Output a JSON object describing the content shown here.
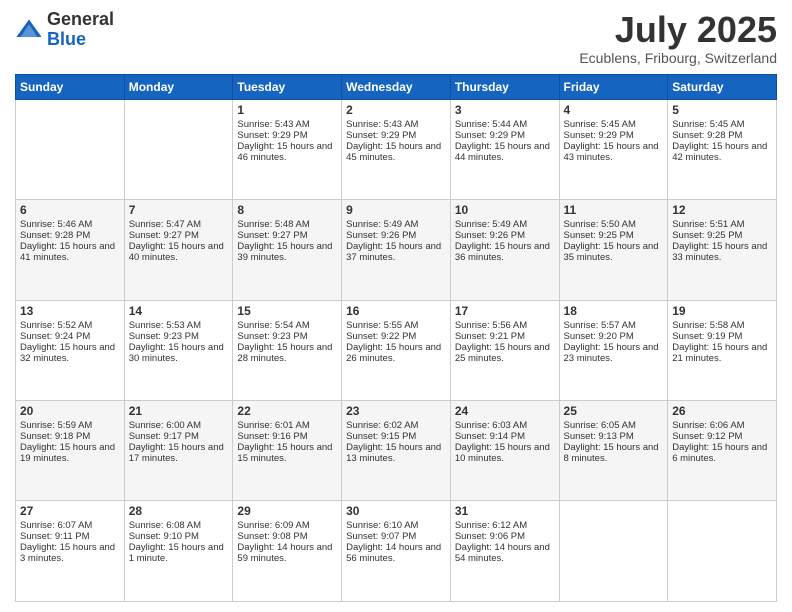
{
  "logo": {
    "general": "General",
    "blue": "Blue"
  },
  "header": {
    "month": "July 2025",
    "location": "Ecublens, Fribourg, Switzerland"
  },
  "weekdays": [
    "Sunday",
    "Monday",
    "Tuesday",
    "Wednesday",
    "Thursday",
    "Friday",
    "Saturday"
  ],
  "weeks": [
    [
      {
        "day": "",
        "sunrise": "",
        "sunset": "",
        "daylight": ""
      },
      {
        "day": "",
        "sunrise": "",
        "sunset": "",
        "daylight": ""
      },
      {
        "day": "1",
        "sunrise": "Sunrise: 5:43 AM",
        "sunset": "Sunset: 9:29 PM",
        "daylight": "Daylight: 15 hours and 46 minutes."
      },
      {
        "day": "2",
        "sunrise": "Sunrise: 5:43 AM",
        "sunset": "Sunset: 9:29 PM",
        "daylight": "Daylight: 15 hours and 45 minutes."
      },
      {
        "day": "3",
        "sunrise": "Sunrise: 5:44 AM",
        "sunset": "Sunset: 9:29 PM",
        "daylight": "Daylight: 15 hours and 44 minutes."
      },
      {
        "day": "4",
        "sunrise": "Sunrise: 5:45 AM",
        "sunset": "Sunset: 9:29 PM",
        "daylight": "Daylight: 15 hours and 43 minutes."
      },
      {
        "day": "5",
        "sunrise": "Sunrise: 5:45 AM",
        "sunset": "Sunset: 9:28 PM",
        "daylight": "Daylight: 15 hours and 42 minutes."
      }
    ],
    [
      {
        "day": "6",
        "sunrise": "Sunrise: 5:46 AM",
        "sunset": "Sunset: 9:28 PM",
        "daylight": "Daylight: 15 hours and 41 minutes."
      },
      {
        "day": "7",
        "sunrise": "Sunrise: 5:47 AM",
        "sunset": "Sunset: 9:27 PM",
        "daylight": "Daylight: 15 hours and 40 minutes."
      },
      {
        "day": "8",
        "sunrise": "Sunrise: 5:48 AM",
        "sunset": "Sunset: 9:27 PM",
        "daylight": "Daylight: 15 hours and 39 minutes."
      },
      {
        "day": "9",
        "sunrise": "Sunrise: 5:49 AM",
        "sunset": "Sunset: 9:26 PM",
        "daylight": "Daylight: 15 hours and 37 minutes."
      },
      {
        "day": "10",
        "sunrise": "Sunrise: 5:49 AM",
        "sunset": "Sunset: 9:26 PM",
        "daylight": "Daylight: 15 hours and 36 minutes."
      },
      {
        "day": "11",
        "sunrise": "Sunrise: 5:50 AM",
        "sunset": "Sunset: 9:25 PM",
        "daylight": "Daylight: 15 hours and 35 minutes."
      },
      {
        "day": "12",
        "sunrise": "Sunrise: 5:51 AM",
        "sunset": "Sunset: 9:25 PM",
        "daylight": "Daylight: 15 hours and 33 minutes."
      }
    ],
    [
      {
        "day": "13",
        "sunrise": "Sunrise: 5:52 AM",
        "sunset": "Sunset: 9:24 PM",
        "daylight": "Daylight: 15 hours and 32 minutes."
      },
      {
        "day": "14",
        "sunrise": "Sunrise: 5:53 AM",
        "sunset": "Sunset: 9:23 PM",
        "daylight": "Daylight: 15 hours and 30 minutes."
      },
      {
        "day": "15",
        "sunrise": "Sunrise: 5:54 AM",
        "sunset": "Sunset: 9:23 PM",
        "daylight": "Daylight: 15 hours and 28 minutes."
      },
      {
        "day": "16",
        "sunrise": "Sunrise: 5:55 AM",
        "sunset": "Sunset: 9:22 PM",
        "daylight": "Daylight: 15 hours and 26 minutes."
      },
      {
        "day": "17",
        "sunrise": "Sunrise: 5:56 AM",
        "sunset": "Sunset: 9:21 PM",
        "daylight": "Daylight: 15 hours and 25 minutes."
      },
      {
        "day": "18",
        "sunrise": "Sunrise: 5:57 AM",
        "sunset": "Sunset: 9:20 PM",
        "daylight": "Daylight: 15 hours and 23 minutes."
      },
      {
        "day": "19",
        "sunrise": "Sunrise: 5:58 AM",
        "sunset": "Sunset: 9:19 PM",
        "daylight": "Daylight: 15 hours and 21 minutes."
      }
    ],
    [
      {
        "day": "20",
        "sunrise": "Sunrise: 5:59 AM",
        "sunset": "Sunset: 9:18 PM",
        "daylight": "Daylight: 15 hours and 19 minutes."
      },
      {
        "day": "21",
        "sunrise": "Sunrise: 6:00 AM",
        "sunset": "Sunset: 9:17 PM",
        "daylight": "Daylight: 15 hours and 17 minutes."
      },
      {
        "day": "22",
        "sunrise": "Sunrise: 6:01 AM",
        "sunset": "Sunset: 9:16 PM",
        "daylight": "Daylight: 15 hours and 15 minutes."
      },
      {
        "day": "23",
        "sunrise": "Sunrise: 6:02 AM",
        "sunset": "Sunset: 9:15 PM",
        "daylight": "Daylight: 15 hours and 13 minutes."
      },
      {
        "day": "24",
        "sunrise": "Sunrise: 6:03 AM",
        "sunset": "Sunset: 9:14 PM",
        "daylight": "Daylight: 15 hours and 10 minutes."
      },
      {
        "day": "25",
        "sunrise": "Sunrise: 6:05 AM",
        "sunset": "Sunset: 9:13 PM",
        "daylight": "Daylight: 15 hours and 8 minutes."
      },
      {
        "day": "26",
        "sunrise": "Sunrise: 6:06 AM",
        "sunset": "Sunset: 9:12 PM",
        "daylight": "Daylight: 15 hours and 6 minutes."
      }
    ],
    [
      {
        "day": "27",
        "sunrise": "Sunrise: 6:07 AM",
        "sunset": "Sunset: 9:11 PM",
        "daylight": "Daylight: 15 hours and 3 minutes."
      },
      {
        "day": "28",
        "sunrise": "Sunrise: 6:08 AM",
        "sunset": "Sunset: 9:10 PM",
        "daylight": "Daylight: 15 hours and 1 minute."
      },
      {
        "day": "29",
        "sunrise": "Sunrise: 6:09 AM",
        "sunset": "Sunset: 9:08 PM",
        "daylight": "Daylight: 14 hours and 59 minutes."
      },
      {
        "day": "30",
        "sunrise": "Sunrise: 6:10 AM",
        "sunset": "Sunset: 9:07 PM",
        "daylight": "Daylight: 14 hours and 56 minutes."
      },
      {
        "day": "31",
        "sunrise": "Sunrise: 6:12 AM",
        "sunset": "Sunset: 9:06 PM",
        "daylight": "Daylight: 14 hours and 54 minutes."
      },
      {
        "day": "",
        "sunrise": "",
        "sunset": "",
        "daylight": ""
      },
      {
        "day": "",
        "sunrise": "",
        "sunset": "",
        "daylight": ""
      }
    ]
  ]
}
